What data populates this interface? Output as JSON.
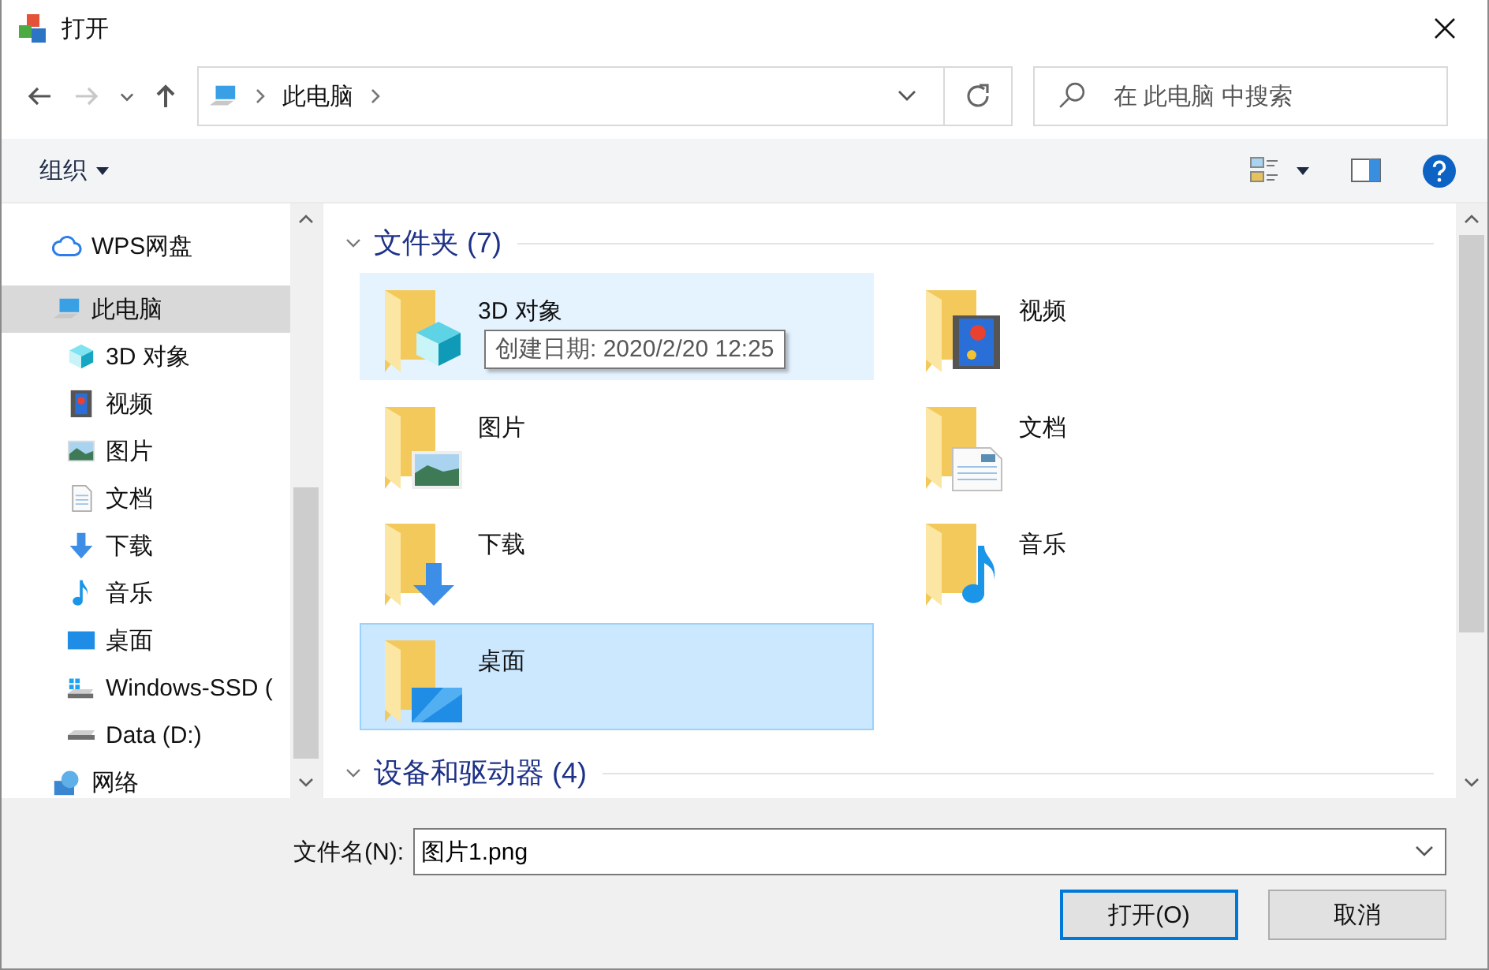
{
  "window": {
    "title": "打开"
  },
  "nav": {
    "back_disabled": false,
    "forward_disabled": true,
    "breadcrumb": [
      "此电脑"
    ]
  },
  "search": {
    "placeholder": "在 此电脑 中搜索"
  },
  "toolbar": {
    "organize": "组织"
  },
  "sidebar": {
    "items": [
      {
        "kind": "cloud",
        "label": "WPS网盘",
        "selected": false
      },
      {
        "kind": "pc",
        "label": "此电脑",
        "selected": true,
        "children": [
          {
            "kind": "cube",
            "label": "3D 对象",
            "selected": false
          },
          {
            "kind": "video",
            "label": "视频",
            "selected": false
          },
          {
            "kind": "picture",
            "label": "图片",
            "selected": false
          },
          {
            "kind": "document",
            "label": "文档",
            "selected": false
          },
          {
            "kind": "download",
            "label": "下载",
            "selected": false
          },
          {
            "kind": "music",
            "label": "音乐",
            "selected": false
          },
          {
            "kind": "desktop",
            "label": "桌面",
            "selected": false
          },
          {
            "kind": "windrive",
            "label": "Windows-SSD (",
            "selected": false
          },
          {
            "kind": "drive",
            "label": "Data (D:)",
            "selected": false
          }
        ]
      },
      {
        "kind": "network",
        "label": "网络",
        "selected": false
      }
    ]
  },
  "groups": [
    {
      "title": "文件夹 (7)",
      "expanded": true,
      "items": [
        {
          "kind": "cube",
          "label": "3D 对象",
          "selected": false,
          "hovered": true
        },
        {
          "kind": "video",
          "label": "视频",
          "selected": false,
          "hovered": false
        },
        {
          "kind": "picture",
          "label": "图片",
          "selected": false,
          "hovered": false
        },
        {
          "kind": "document",
          "label": "文档",
          "selected": false,
          "hovered": false
        },
        {
          "kind": "download",
          "label": "下载",
          "selected": false,
          "hovered": false
        },
        {
          "kind": "music",
          "label": "音乐",
          "selected": false,
          "hovered": false
        },
        {
          "kind": "desktop",
          "label": "桌面",
          "selected": true,
          "hovered": false
        }
      ]
    },
    {
      "title": "设备和驱动器 (4)",
      "expanded": true
    }
  ],
  "tooltip": "创建日期: 2020/2/20 12:25",
  "filename": {
    "label": "文件名(N):",
    "value": "图片1.png"
  },
  "buttons": [
    {
      "label": "打开(O)",
      "default": true
    },
    {
      "label": "取消",
      "default": false
    }
  ]
}
